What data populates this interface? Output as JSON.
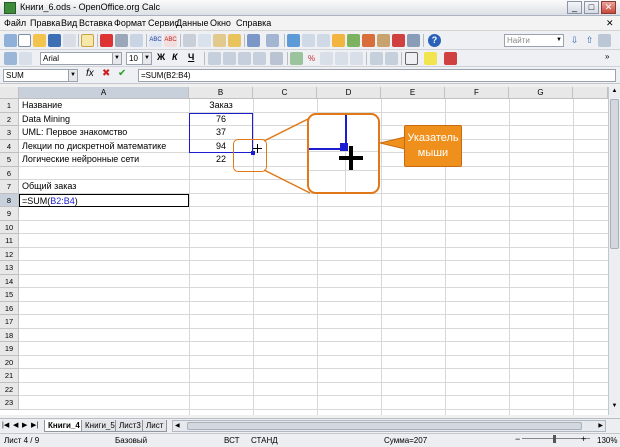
{
  "window": {
    "title": "Книги_6.ods - OpenOffice.org Calc"
  },
  "menu": [
    "Файл",
    "Правка",
    "Вид",
    "Вставка",
    "Формат",
    "Сервис",
    "Данные",
    "Окно",
    "Справка"
  ],
  "toolbar": {
    "find_placeholder": "Найти"
  },
  "format_bar": {
    "font_name": "Arial",
    "font_size": "10",
    "bold": "Ж",
    "italic": "К",
    "underline": "Ч"
  },
  "formula_bar": {
    "name_box": "SUM",
    "formula": "=SUM(B2:B4)"
  },
  "sheet": {
    "columns": [
      "A",
      "B",
      "C",
      "D",
      "E",
      "F",
      "G"
    ],
    "rows": [
      "1",
      "2",
      "3",
      "4",
      "5",
      "6",
      "7",
      "8",
      "9",
      "10",
      "11",
      "12",
      "13",
      "14",
      "15",
      "16",
      "17",
      "18",
      "19",
      "20",
      "21",
      "22",
      "23"
    ],
    "cells": {
      "A1": "Название",
      "B1": "Заказ",
      "A2": "Data Mining",
      "B2": "76",
      "A3": "UML: Первое знакомство",
      "B3": "37",
      "A4": "Лекции по дискретной математике",
      "B4": "94",
      "A5": "Логические нейронные сети",
      "B5": "22",
      "A7": "Общий заказ",
      "A8_prefix": "=SUM(",
      "A8_ref": "B2:B4",
      "A8_suffix": ")"
    }
  },
  "callout": {
    "text": "Указатель мыши"
  },
  "tabs": [
    "Книги_4",
    "Книги_5",
    "Лист3",
    "Лист"
  ],
  "status": {
    "sheet": "Лист 4 / 9",
    "style": "Базовый",
    "insert_mode": "ВСТ",
    "selection_mode": "СТАНД",
    "sum": "Сумма=207",
    "zoom": "130%"
  },
  "colors": {
    "accent_blue": "#1c1cd0",
    "callout_orange": "#e07818",
    "callout_fill": "#f0901c"
  }
}
